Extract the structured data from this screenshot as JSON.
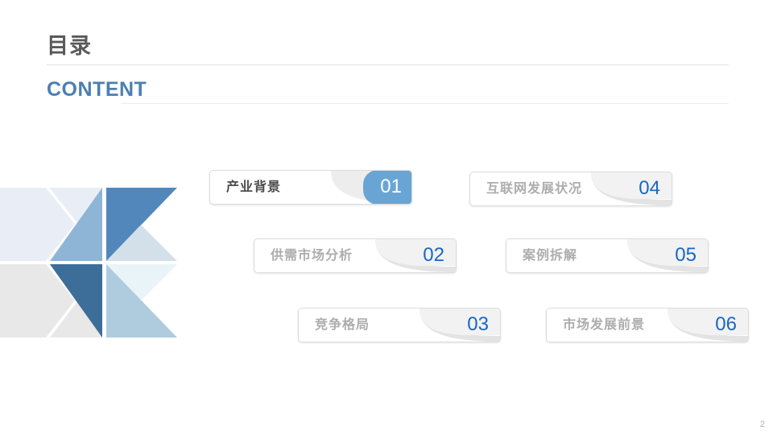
{
  "header": {
    "title": "目录",
    "subtitle": "CONTENT"
  },
  "colors": {
    "accent_blue": "#4b7fb3",
    "number_blue": "#1767c4",
    "active_badge": "#69a5d4",
    "title_gray": "#5a5a5a",
    "label_gray": "#adadad",
    "active_label": "#4d4d4d",
    "rule_gray": "#e2e2e2",
    "deco_pale_blue": "#e9eef6",
    "deco_light_blue": "#8fb5d6",
    "deco_mid_blue": "#5287bb",
    "deco_soft_blue": "#d3e0ea",
    "deco_gray": "#e8e8e8",
    "deco_dark_blue": "#3d6e99",
    "deco_ice": "#e8f4f8",
    "deco_steel_blue": "#afccde"
  },
  "decoration": {
    "name": "pinwheel-triangles-graphic"
  },
  "contents": {
    "items": [
      {
        "label": "产业背景",
        "number": "01",
        "active": true
      },
      {
        "label": "供需市场分析",
        "number": "02",
        "active": false
      },
      {
        "label": "竞争格局",
        "number": "03",
        "active": false
      },
      {
        "label": "互联网发展状况",
        "number": "04",
        "active": false
      },
      {
        "label": "案例拆解",
        "number": "05",
        "active": false
      },
      {
        "label": "市场发展前景",
        "number": "06",
        "active": false
      }
    ]
  },
  "footer": {
    "page_number": "2"
  }
}
